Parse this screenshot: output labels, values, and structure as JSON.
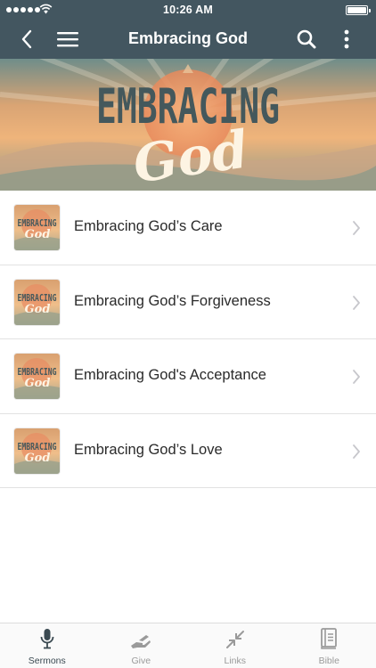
{
  "status_bar": {
    "time": "10:26 AM"
  },
  "header": {
    "title": "Embracing God"
  },
  "banner": {
    "line1": "EMBRACING",
    "line2": "God"
  },
  "thumb_text": {
    "line1": "EMBRACING",
    "line2": "God"
  },
  "sermons": [
    {
      "title": "Embracing God’s Care"
    },
    {
      "title": "Embracing God’s Forgiveness"
    },
    {
      "title": "Embracing God's Acceptance"
    },
    {
      "title": "Embracing God’s Love"
    }
  ],
  "tabs": [
    {
      "label": "Sermons",
      "icon": "microphone-icon",
      "active": true
    },
    {
      "label": "Give",
      "icon": "giving-hand-icon",
      "active": false
    },
    {
      "label": "Links",
      "icon": "collapse-arrows-icon",
      "active": false
    },
    {
      "label": "Bible",
      "icon": "book-icon",
      "active": false
    }
  ],
  "colors": {
    "header_bg": "#435660",
    "banner_warm": "#e8a66a",
    "banner_teal": "#6a8a86",
    "active_tab": "#3b4a52",
    "inactive_tab": "#9a9a9a"
  }
}
